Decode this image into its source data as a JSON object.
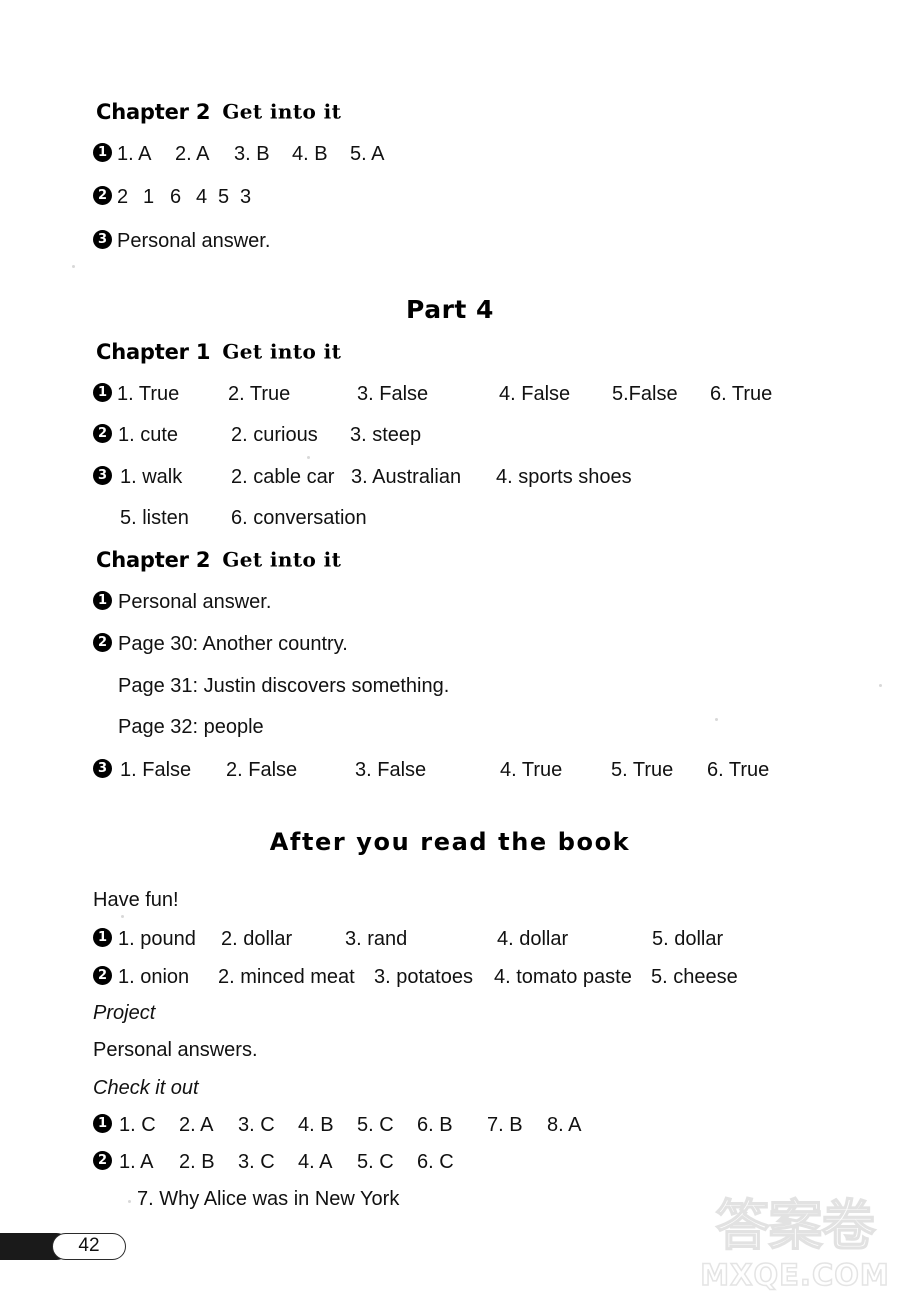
{
  "page": {
    "number": "42",
    "background": "#ffffff",
    "ink_color": "#111111"
  },
  "watermark": {
    "chinese": "答案卷",
    "domain": "MXQE.COM",
    "color": "#e3e3e3"
  },
  "blocks": [
    {
      "id": "chapter2-top",
      "type": "chapter-heading",
      "chapter": "Chapter 2",
      "label": "Get into it"
    },
    {
      "id": "c2-q1",
      "type": "answer-row",
      "bullet": "1",
      "items": [
        "1. A",
        "2. A",
        "3. B",
        "4. B",
        "5. A"
      ]
    },
    {
      "id": "c2-q2",
      "type": "answer-row",
      "bullet": "2",
      "items": [
        "2",
        "1",
        "6",
        "4",
        "5",
        "3"
      ]
    },
    {
      "id": "c2-q3",
      "type": "answer-row",
      "bullet": "3",
      "items": [
        "Personal answer."
      ]
    },
    {
      "id": "part4",
      "type": "part-title",
      "text": "Part 4"
    },
    {
      "id": "p4-chapter1",
      "type": "chapter-heading",
      "chapter": "Chapter 1",
      "label": "Get into it"
    },
    {
      "id": "p4c1-q1",
      "type": "answer-row",
      "bullet": "1",
      "items": [
        "1. True",
        "2. True",
        "3. False",
        "4. False",
        "5.False",
        "6. True"
      ]
    },
    {
      "id": "p4c1-q2",
      "type": "answer-row",
      "bullet": "2",
      "items": [
        "1. cute",
        "2. curious",
        "3. steep"
      ]
    },
    {
      "id": "p4c1-q3",
      "type": "answer-row",
      "bullet": "3",
      "items": [
        "1. walk",
        "2. cable car",
        "3. Australian",
        "4. sports shoes"
      ]
    },
    {
      "id": "p4c1-q3-cont",
      "type": "answer-row-continued",
      "items": [
        "5. listen",
        "6. conversation"
      ]
    },
    {
      "id": "p4-chapter2",
      "type": "chapter-heading",
      "chapter": "Chapter 2",
      "label": "Get into it"
    },
    {
      "id": "p4c2-q1",
      "type": "answer-row",
      "bullet": "1",
      "items": [
        "Personal answer."
      ]
    },
    {
      "id": "p4c2-q2",
      "type": "answer-row",
      "bullet": "2",
      "items": [
        "Page 30: Another country."
      ]
    },
    {
      "id": "p4c2-q2-line2",
      "type": "answer-row-continued",
      "items": [
        "Page 31: Justin discovers something."
      ]
    },
    {
      "id": "p4c2-q2-line3",
      "type": "answer-row-continued",
      "items": [
        "Page 32: people"
      ]
    },
    {
      "id": "p4c2-q3",
      "type": "answer-row",
      "bullet": "3",
      "items": [
        "1. False",
        "2. False",
        "3. False",
        "4. True",
        "5. True",
        "6. True"
      ]
    },
    {
      "id": "after-you-read",
      "type": "section-title",
      "text": "After you read the book"
    },
    {
      "id": "have-fun",
      "type": "plain-heading",
      "text": "Have fun!"
    },
    {
      "id": "hf-q1",
      "type": "answer-row",
      "bullet": "1",
      "items": [
        "1. pound",
        "2. dollar",
        "3. rand",
        "4. dollar",
        "5. dollar"
      ]
    },
    {
      "id": "hf-q2",
      "type": "answer-row",
      "bullet": "2",
      "items": [
        "1. onion",
        "2. minced meat",
        "3. potatoes",
        "4. tomato paste",
        "5. cheese"
      ]
    },
    {
      "id": "project",
      "type": "slant-heading",
      "text": "Project"
    },
    {
      "id": "project-answer",
      "type": "plain-heading",
      "text": "Personal answers."
    },
    {
      "id": "check-it-out",
      "type": "slant-heading",
      "text": "Check it out"
    },
    {
      "id": "cio-q1",
      "type": "answer-row",
      "bullet": "1",
      "items": [
        "1. C",
        "2. A",
        "3. C",
        "4. B",
        "5. C",
        "6. B",
        "7. B",
        "8. A"
      ]
    },
    {
      "id": "cio-q2",
      "type": "answer-row",
      "bullet": "2",
      "items": [
        "1. A",
        "2. B",
        "3. C",
        "4. A",
        "5. C",
        "6. C"
      ]
    },
    {
      "id": "cio-q2-cont",
      "type": "answer-row-continued",
      "items": [
        "7. Why Alice was in New York"
      ]
    }
  ]
}
